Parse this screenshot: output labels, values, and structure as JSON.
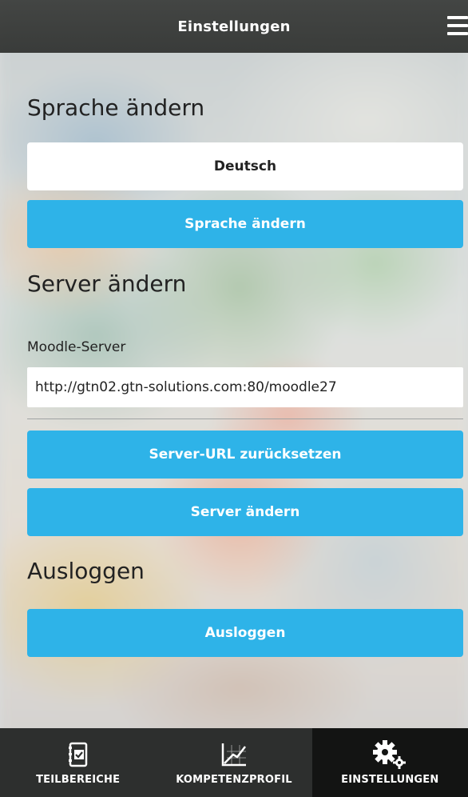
{
  "header": {
    "title": "Einstellungen",
    "menu_icon": "hamburger-menu-icon"
  },
  "language_section": {
    "title": "Sprache ändern",
    "selected_language": "Deutsch",
    "change_button": "Sprache ändern"
  },
  "server_section": {
    "title": "Server ändern",
    "field_label": "Moodle-Server",
    "server_url": "http://gtn02.gtn-solutions.com:80/moodle27",
    "reset_button": "Server-URL zurücksetzen",
    "change_button": "Server ändern"
  },
  "logout_section": {
    "title": "Ausloggen",
    "logout_button": "Ausloggen"
  },
  "tabs": [
    {
      "label": "TEILBEREICHE",
      "icon": "notebook-check-icon",
      "active": false
    },
    {
      "label": "KOMPETENZPROFIL",
      "icon": "chart-icon",
      "active": false
    },
    {
      "label": "EINSTELLUNGEN",
      "icon": "gears-icon",
      "active": true
    }
  ],
  "colors": {
    "accent": "#2eb3e8",
    "header": "#373937",
    "tabbar": "#2d2f2e",
    "tab_active": "#131413"
  }
}
